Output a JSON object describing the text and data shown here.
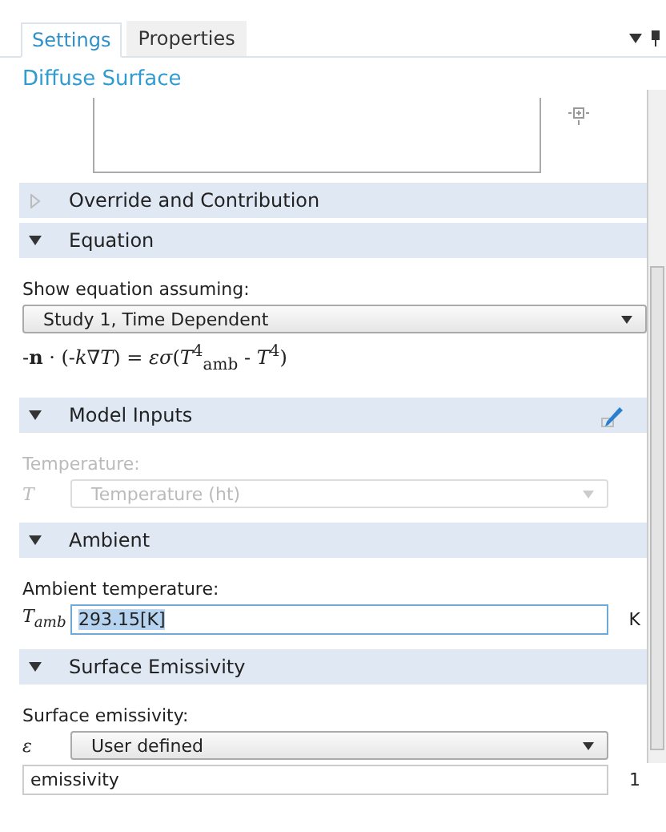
{
  "tabs": [
    {
      "label": "Settings",
      "selected": true
    },
    {
      "label": "Properties",
      "selected": false
    }
  ],
  "title": "Diffuse Surface",
  "sections": [
    {
      "title": "Override and Contribution",
      "expanded": false
    },
    {
      "title": "Equation",
      "expanded": true,
      "items": [
        {
          "kind": "label",
          "text": "Show equation assuming:",
          "disabled": false
        },
        {
          "kind": "select",
          "value": "Study 1, Time Dependent",
          "disabled": false
        },
        {
          "kind": "equation",
          "text": "-**n** · (-*k*∇*T*) = *εσ*(*T*$^{4}$$_{amb}$ - *T*$^{4}$)"
        }
      ]
    },
    {
      "title": "Model Inputs",
      "expanded": true,
      "edit_button": true,
      "items": [
        {
          "kind": "label",
          "text": "Temperature:",
          "disabled": true
        },
        {
          "kind": "select",
          "symbol": "T",
          "value": "Temperature (ht)",
          "disabled": true
        }
      ]
    },
    {
      "title": "Ambient",
      "expanded": true,
      "items": [
        {
          "kind": "label",
          "text": "Ambient temperature:",
          "disabled": false
        },
        {
          "kind": "input",
          "symbol": "*T*$_{amb}$",
          "value": "293.15[K]",
          "text_selected": true,
          "unit": "K"
        }
      ]
    },
    {
      "title": "Surface Emissivity",
      "expanded": true,
      "items": [
        {
          "kind": "label",
          "text": "Surface emissivity:",
          "disabled": false
        },
        {
          "kind": "select",
          "symbol": "ε",
          "value": "User defined",
          "disabled": false
        },
        {
          "kind": "input",
          "value": "emissivity",
          "text_selected": false,
          "unit": "1"
        }
      ]
    }
  ]
}
